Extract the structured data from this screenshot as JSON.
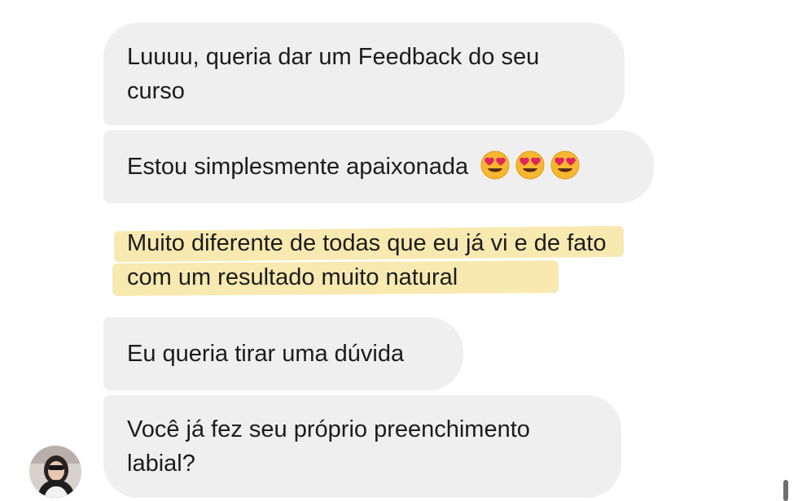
{
  "conversation": {
    "messages": [
      {
        "text": "Luuuu, queria dar um Feedback do seu curso"
      },
      {
        "text": "Estou simplesmente apaixonada",
        "emojis": [
          "heart-eyes-emoji",
          "heart-eyes-emoji",
          "heart-eyes-emoji"
        ]
      },
      {
        "text": "Muito diferente de todas que eu já vi e de fato com um resultado muito natural",
        "highlighted": true,
        "highlight_color": "#f6e296"
      },
      {
        "text": "Eu queria tirar uma dúvida"
      },
      {
        "text": "Você já fez seu próprio preenchimento labial?"
      }
    ],
    "bubble_color": "#efefef",
    "text_color": "#1c1c1c",
    "sender_avatar": "sender-avatar-photo"
  }
}
